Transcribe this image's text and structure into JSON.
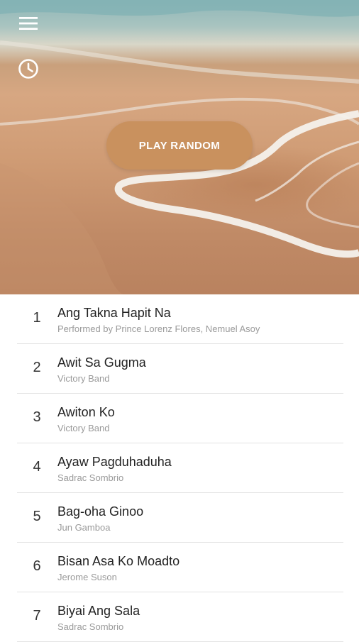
{
  "header": {
    "menu_icon": "hamburger-menu-icon",
    "history_icon": "clock-icon",
    "play_random_label": "PLAY RANDOM"
  },
  "colors": {
    "accent": "#c9915e",
    "title_text": "#222222",
    "subtitle_text": "#9a9a9a",
    "divider": "#e3e3e3"
  },
  "songs": [
    {
      "number": "1",
      "title": "Ang Takna Hapit Na",
      "artist": "Performed by Prince Lorenz Flores, Nemuel Asoy"
    },
    {
      "number": "2",
      "title": "Awit Sa Gugma",
      "artist": "Victory Band"
    },
    {
      "number": "3",
      "title": "Awiton Ko",
      "artist": "Victory Band"
    },
    {
      "number": "4",
      "title": "Ayaw Pagduhaduha",
      "artist": "Sadrac Sombrio"
    },
    {
      "number": "5",
      "title": "Bag-oha Ginoo",
      "artist": "Jun Gamboa"
    },
    {
      "number": "6",
      "title": "Bisan Asa Ko Moadto",
      "artist": "Jerome Suson"
    },
    {
      "number": "7",
      "title": "Biyai Ang Sala",
      "artist": "Sadrac Sombrio"
    }
  ]
}
